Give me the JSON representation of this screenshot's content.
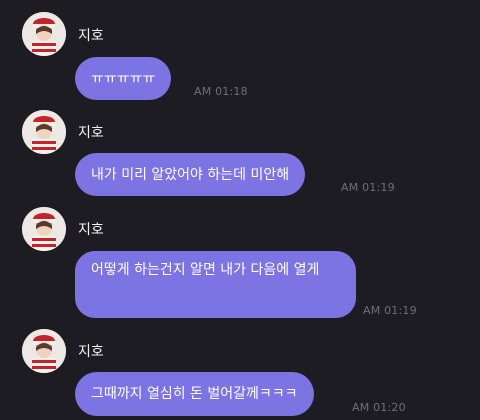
{
  "theme": {
    "background": "#1c1c22",
    "bubble": "#7c74e2",
    "name_text": "#f2f2f4",
    "time_text": "#6e6e76"
  },
  "messages": [
    {
      "sender": "지호",
      "avatar_icon": "profile-avatar",
      "text": "ㅠㅠㅠㅠㅠ",
      "time": "AM 01:18"
    },
    {
      "sender": "지호",
      "avatar_icon": "profile-avatar",
      "text": "내가 미리 알았어야 하는데 미안해",
      "time": "AM 01:19"
    },
    {
      "sender": "지호",
      "avatar_icon": "profile-avatar",
      "text": "어떻게 하는건지 알면 내가 다음에 열게",
      "time": "AM 01:19"
    },
    {
      "sender": "지호",
      "avatar_icon": "profile-avatar",
      "text": "그때까지 열심히 돈 벌어갈께ㅋㅋㅋ",
      "time": "AM 01:20"
    }
  ]
}
